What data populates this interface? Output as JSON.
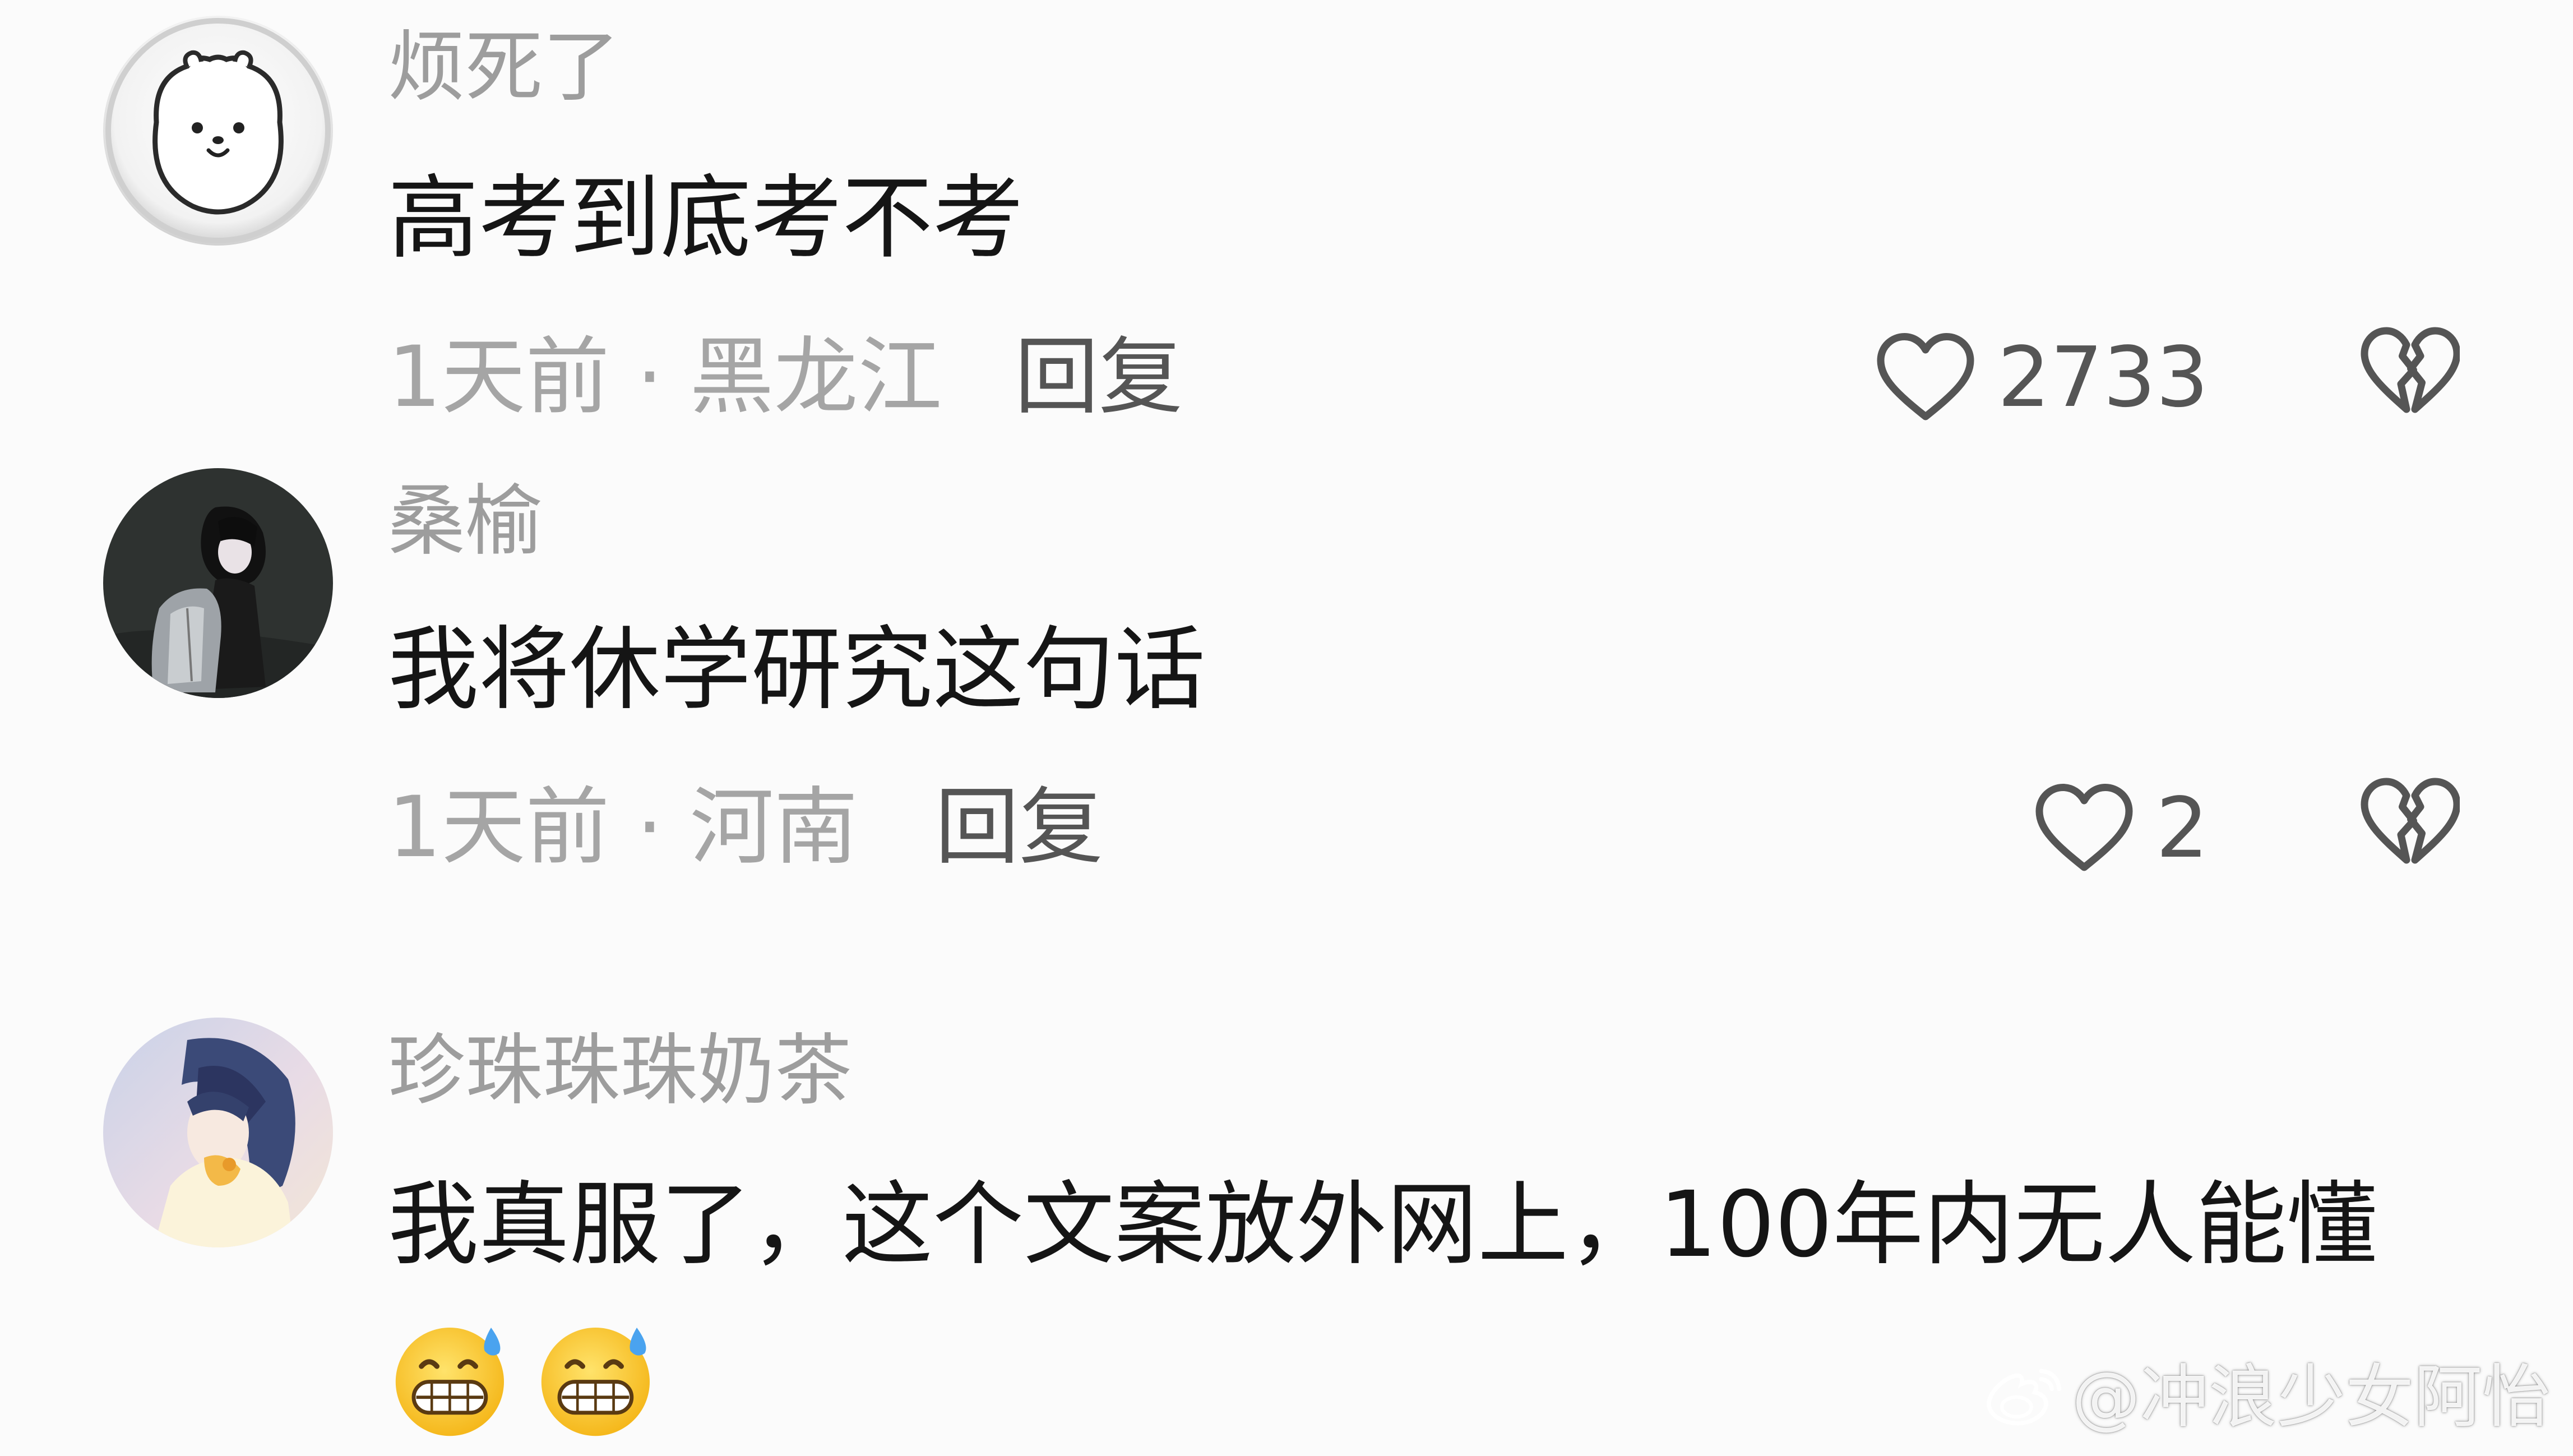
{
  "comments": [
    {
      "username": "烦死了",
      "text": "高考到底考不考",
      "meta": "1天前 · 黑龙江",
      "reply_label": "回复",
      "like_count": "2733",
      "avatar": "white-bear-avatar"
    },
    {
      "username": "桑榆",
      "text": "我将休学研究这句话",
      "meta": "1天前 · 河南",
      "reply_label": "回复",
      "like_count": "2",
      "avatar": "anime-girl-dark-avatar"
    },
    {
      "username": "珍珠珠珠奶茶",
      "text": "我真服了，这个文案放外网上，100年内无人能懂",
      "emojis": [
        "grimacing-sweat-emoji",
        "grimacing-sweat-emoji"
      ],
      "avatar": "anime-girl-pastel-avatar"
    }
  ],
  "watermark": {
    "text": "@冲浪少女阿怡",
    "icon": "weibo-icon"
  },
  "colors": {
    "background": "#fbfbfb",
    "username": "#9d9d9d",
    "comment_text": "#151515",
    "meta": "#a5a5a5",
    "action": "#555555"
  }
}
